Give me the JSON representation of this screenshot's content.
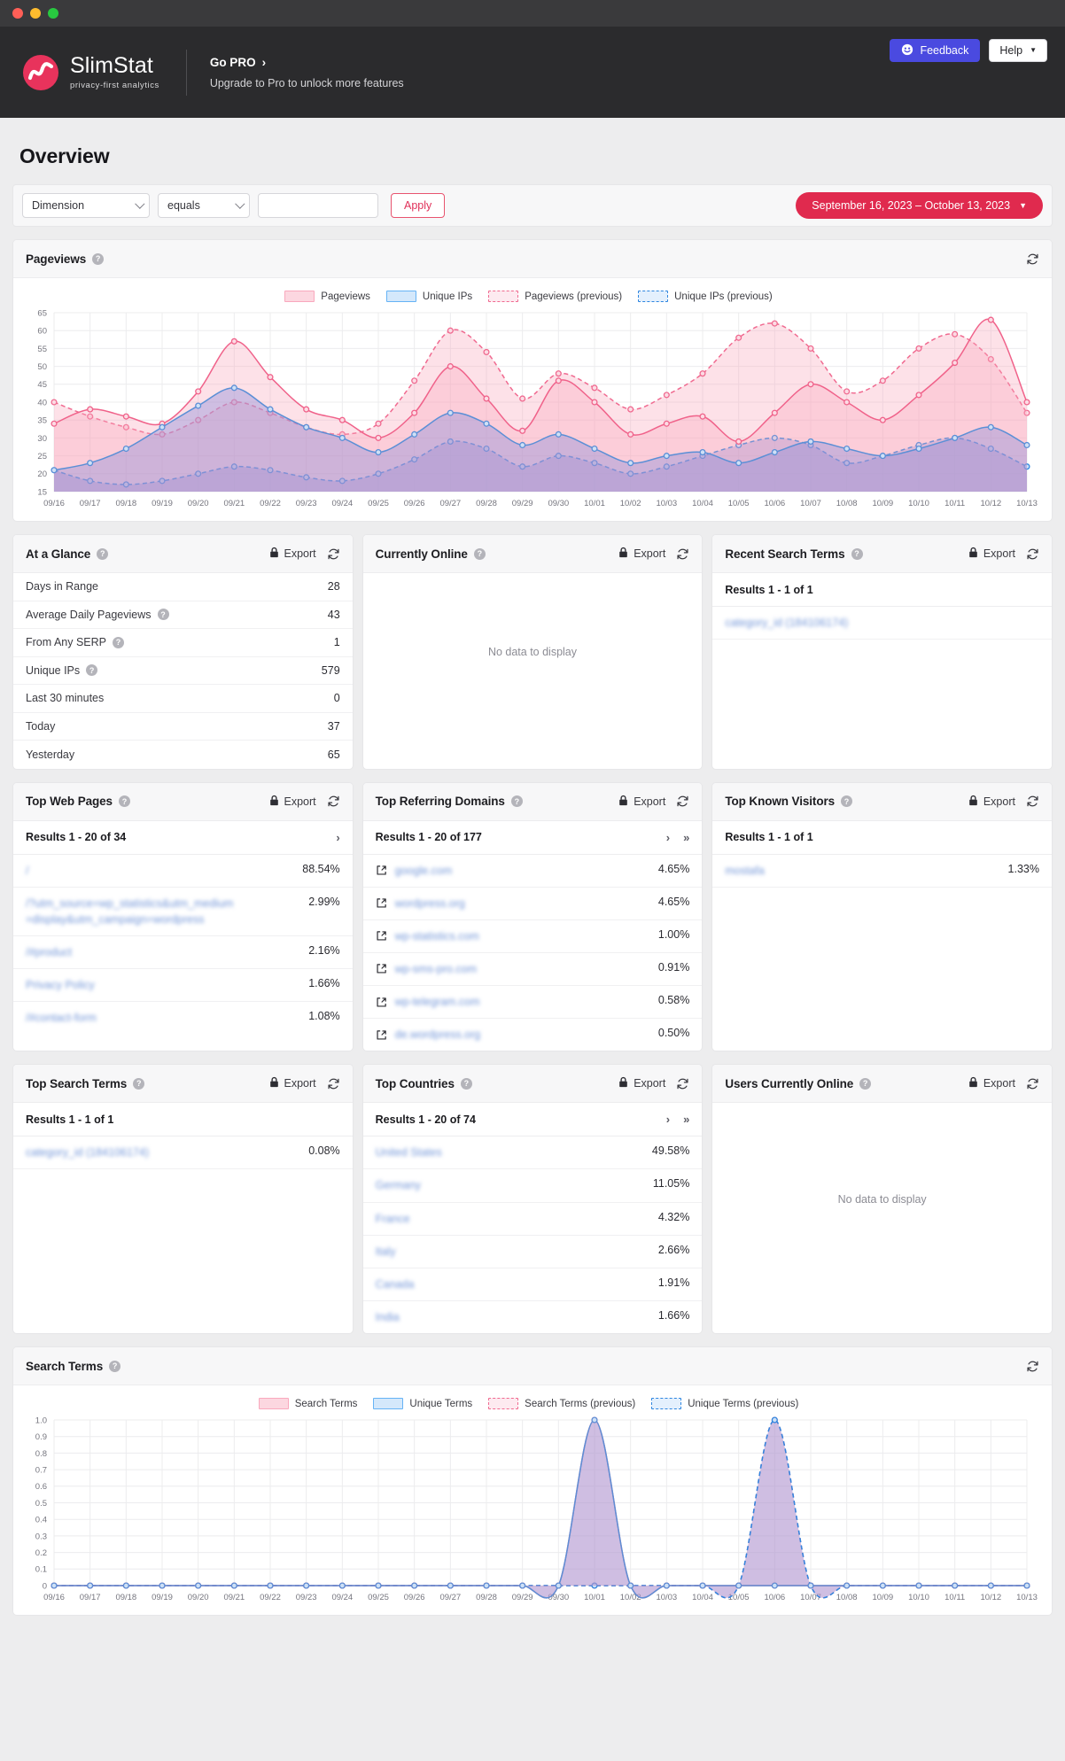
{
  "window": {
    "traffic_lights": [
      "close",
      "minimize",
      "zoom"
    ]
  },
  "header": {
    "brand_name": "SlimStat",
    "brand_tagline": "privacy-first analytics",
    "promo_title": "Go PRO",
    "promo_chevron": "›",
    "promo_subtitle": "Upgrade to Pro to unlock more features",
    "feedback_label": "Feedback",
    "feedback_icon": "smiley-icon",
    "help_label": "Help",
    "help_caret": "▼",
    "feedback_color": "#4a4ae0",
    "logo_color": "#e8335c"
  },
  "page": {
    "title": "Overview"
  },
  "filters": {
    "dimension_value": "Dimension",
    "operator_value": "equals",
    "value_text": "",
    "value_placeholder": "",
    "apply_label": "Apply",
    "date_range": "September 16, 2023 – October 13, 2023",
    "date_caret": "▼",
    "accent_color": "#e02a4e"
  },
  "common": {
    "export_label": "Export",
    "lock_icon": "lock-icon",
    "refresh_icon": "refresh-icon",
    "help_icon": "?",
    "no_data": "No data to display",
    "next_page": "›",
    "last_page": "»"
  },
  "pageviews_card": {
    "title": "Pageviews",
    "legend": [
      {
        "label": "Pageviews",
        "style": "solid",
        "color": "#f9a8bd"
      },
      {
        "label": "Unique IPs",
        "style": "solid",
        "color": "#66b3f5"
      },
      {
        "label": "Pageviews (previous)",
        "style": "dashed",
        "color": "#f06a90"
      },
      {
        "label": "Unique IPs (previous)",
        "style": "dashed",
        "color": "#2e86e0"
      }
    ]
  },
  "search_terms_card": {
    "title": "Search Terms",
    "legend": [
      {
        "label": "Search Terms",
        "style": "solid",
        "color": "#f9a8bd"
      },
      {
        "label": "Unique Terms",
        "style": "solid",
        "color": "#66b3f5"
      },
      {
        "label": "Search Terms (previous)",
        "style": "dashed",
        "color": "#f06a90"
      },
      {
        "label": "Unique Terms (previous)",
        "style": "dashed",
        "color": "#2e86e0"
      }
    ]
  },
  "at_a_glance": {
    "title": "At a Glance",
    "rows": [
      {
        "label": "Days in Range",
        "value": "28",
        "help": false
      },
      {
        "label": "Average Daily Pageviews",
        "value": "43",
        "help": true
      },
      {
        "label": "From Any SERP",
        "value": "1",
        "help": true
      },
      {
        "label": "Unique IPs",
        "value": "579",
        "help": true
      },
      {
        "label": "Last 30 minutes",
        "value": "0",
        "help": false
      },
      {
        "label": "Today",
        "value": "37",
        "help": false
      },
      {
        "label": "Yesterday",
        "value": "65",
        "help": false
      }
    ]
  },
  "currently_online": {
    "title": "Currently Online",
    "empty_text": "No data to display"
  },
  "recent_search_terms": {
    "title": "Recent Search Terms",
    "results_label": "Results 1 - 1 of 1",
    "rows": [
      {
        "label": "category_id (184106174)",
        "value": ""
      }
    ]
  },
  "top_web_pages": {
    "title": "Top Web Pages",
    "results_label": "Results 1 - 20 of 34",
    "rows": [
      {
        "label": "/",
        "value": "88.54%"
      },
      {
        "label": "/?utm_source=wp_statistics&utm_medium=display&utm_campaign=wordpress",
        "value": "2.99%"
      },
      {
        "label": "/#product",
        "value": "2.16%"
      },
      {
        "label": "Privacy Policy",
        "value": "1.66%"
      },
      {
        "label": "/#contact-form",
        "value": "1.08%"
      }
    ]
  },
  "top_referring_domains": {
    "title": "Top Referring Domains",
    "results_label": "Results 1 - 20 of 177",
    "rows": [
      {
        "label": "google.com",
        "value": "4.65%"
      },
      {
        "label": "wordpress.org",
        "value": "4.65%"
      },
      {
        "label": "wp-statistics.com",
        "value": "1.00%"
      },
      {
        "label": "wp-sms-pro.com",
        "value": "0.91%"
      },
      {
        "label": "wp-telegram.com",
        "value": "0.58%"
      },
      {
        "label": "de.wordpress.org",
        "value": "0.50%"
      }
    ]
  },
  "top_known_visitors": {
    "title": "Top Known Visitors",
    "results_label": "Results 1 - 1 of 1",
    "rows": [
      {
        "label": "mostafa",
        "value": "1.33%"
      }
    ]
  },
  "top_search_terms": {
    "title": "Top Search Terms",
    "results_label": "Results 1 - 1 of 1",
    "rows": [
      {
        "label": "category_id (184106174)",
        "value": "0.08%"
      }
    ]
  },
  "top_countries": {
    "title": "Top Countries",
    "results_label": "Results 1 - 20 of 74",
    "rows": [
      {
        "label": "United States",
        "value": "49.58%"
      },
      {
        "label": "Germany",
        "value": "11.05%"
      },
      {
        "label": "France",
        "value": "4.32%"
      },
      {
        "label": "Italy",
        "value": "2.66%"
      },
      {
        "label": "Canada",
        "value": "1.91%"
      },
      {
        "label": "India",
        "value": "1.66%"
      }
    ]
  },
  "users_currently_online": {
    "title": "Users Currently Online",
    "empty_text": "No data to display"
  },
  "chart_data": [
    {
      "id": "pageviews",
      "type": "area",
      "title": "Pageviews",
      "xlabel": "",
      "ylabel": "",
      "ylim": [
        15,
        65
      ],
      "yticks": [
        15,
        20,
        25,
        30,
        35,
        40,
        45,
        50,
        55,
        60,
        65
      ],
      "grid": true,
      "legend_position": "top-center",
      "x": [
        "09/16",
        "09/17",
        "09/18",
        "09/19",
        "09/20",
        "09/21",
        "09/22",
        "09/23",
        "09/24",
        "09/25",
        "09/26",
        "09/27",
        "09/28",
        "09/29",
        "09/30",
        "10/01",
        "10/02",
        "10/03",
        "10/04",
        "10/05",
        "10/06",
        "10/07",
        "10/08",
        "10/09",
        "10/10",
        "10/11",
        "10/12",
        "10/13"
      ],
      "series": [
        {
          "name": "Pageviews",
          "style": "solid",
          "color": "#f0628a",
          "values": [
            34,
            38,
            36,
            34,
            43,
            57,
            47,
            38,
            35,
            30,
            37,
            50,
            41,
            32,
            46,
            40,
            31,
            34,
            36,
            29,
            37,
            45,
            40,
            35,
            42,
            51,
            63,
            40
          ]
        },
        {
          "name": "Unique IPs",
          "style": "solid",
          "color": "#5b8fd6",
          "values": [
            21,
            23,
            27,
            33,
            39,
            44,
            38,
            33,
            30,
            26,
            31,
            37,
            34,
            28,
            31,
            27,
            23,
            25,
            26,
            23,
            26,
            29,
            27,
            25,
            27,
            30,
            33,
            28
          ]
        },
        {
          "name": "Pageviews (previous)",
          "style": "dashed",
          "color": "#f06a90",
          "values": [
            40,
            36,
            33,
            31,
            35,
            40,
            37,
            33,
            31,
            34,
            46,
            60,
            54,
            41,
            48,
            44,
            38,
            42,
            48,
            58,
            62,
            55,
            43,
            46,
            55,
            59,
            52,
            37
          ]
        },
        {
          "name": "Unique IPs (previous)",
          "style": "dashed",
          "color": "#2e86e0",
          "values": [
            21,
            18,
            17,
            18,
            20,
            22,
            21,
            19,
            18,
            20,
            24,
            29,
            27,
            22,
            25,
            23,
            20,
            22,
            25,
            28,
            30,
            28,
            23,
            25,
            28,
            30,
            27,
            22
          ]
        }
      ]
    },
    {
      "id": "search-terms",
      "type": "area",
      "title": "Search Terms",
      "xlabel": "",
      "ylabel": "",
      "ylim": [
        0,
        1.0
      ],
      "yticks": [
        "1.0",
        "0.9",
        "0.8",
        "0.7",
        "0.6",
        "0.5",
        "0.4",
        "0.3",
        "0.2",
        "0.1",
        "0"
      ],
      "grid": true,
      "legend_position": "top-center",
      "x": [
        "09/16",
        "09/17",
        "09/18",
        "09/19",
        "09/20",
        "09/21",
        "09/22",
        "09/23",
        "09/24",
        "09/25",
        "09/26",
        "09/27",
        "09/28",
        "09/29",
        "09/30",
        "10/01",
        "10/02",
        "10/03",
        "10/04",
        "10/05",
        "10/06",
        "10/07",
        "10/08",
        "10/09",
        "10/10",
        "10/11",
        "10/12",
        "10/13"
      ],
      "series": [
        {
          "name": "Search Terms",
          "style": "solid",
          "color": "#f0628a",
          "values": [
            0,
            0,
            0,
            0,
            0,
            0,
            0,
            0,
            0,
            0,
            0,
            0,
            0,
            0,
            0,
            1,
            0,
            0,
            0,
            0,
            0,
            0,
            0,
            0,
            0,
            0,
            0,
            0
          ]
        },
        {
          "name": "Unique Terms",
          "style": "solid",
          "color": "#5b8fd6",
          "values": [
            0,
            0,
            0,
            0,
            0,
            0,
            0,
            0,
            0,
            0,
            0,
            0,
            0,
            0,
            0,
            1,
            0,
            0,
            0,
            0,
            0,
            0,
            0,
            0,
            0,
            0,
            0,
            0
          ]
        },
        {
          "name": "Search Terms (previous)",
          "style": "dashed",
          "color": "#f06a90",
          "values": [
            0,
            0,
            0,
            0,
            0,
            0,
            0,
            0,
            0,
            0,
            0,
            0,
            0,
            0,
            0,
            0,
            0,
            0,
            0,
            0,
            1,
            0,
            0,
            0,
            0,
            0,
            0,
            0
          ]
        },
        {
          "name": "Unique Terms (previous)",
          "style": "dashed",
          "color": "#2e86e0",
          "values": [
            0,
            0,
            0,
            0,
            0,
            0,
            0,
            0,
            0,
            0,
            0,
            0,
            0,
            0,
            0,
            0,
            0,
            0,
            0,
            0,
            1,
            0,
            0,
            0,
            0,
            0,
            0,
            0
          ]
        }
      ]
    }
  ]
}
